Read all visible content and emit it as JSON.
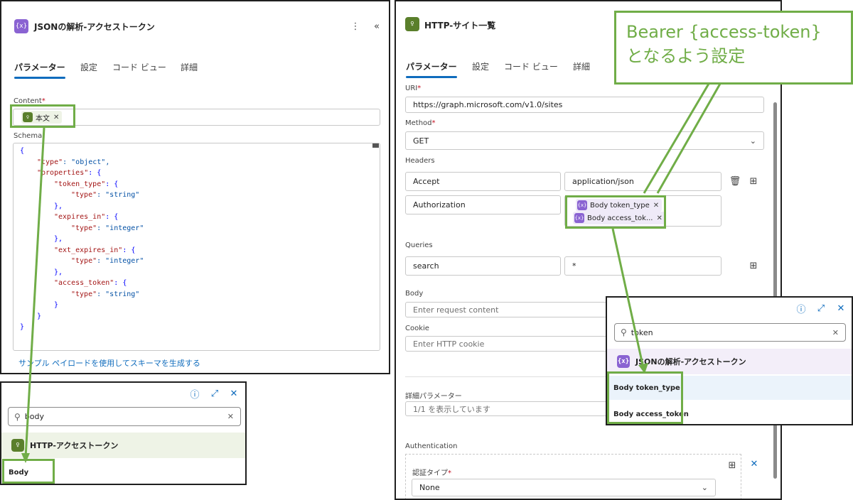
{
  "left_panel": {
    "title": "JSONの解析-アクセストークン",
    "tabs": [
      "パラメーター",
      "設定",
      "コード ビュー",
      "詳細"
    ],
    "content_label": "Content",
    "content_chip": "本文",
    "schema_label": "Schema",
    "schema_lines": [
      {
        "indent": 0,
        "key": "",
        "value": "{"
      },
      {
        "indent": 1,
        "key": "\"type\"",
        "value": ": \"object\","
      },
      {
        "indent": 1,
        "key": "\"properties\"",
        "value": ": {"
      },
      {
        "indent": 2,
        "key": "\"token_type\"",
        "value": ": {"
      },
      {
        "indent": 3,
        "key": "\"type\"",
        "value": ": \"string\""
      },
      {
        "indent": 2,
        "key": "",
        "value": "},"
      },
      {
        "indent": 2,
        "key": "\"expires_in\"",
        "value": ": {"
      },
      {
        "indent": 3,
        "key": "\"type\"",
        "value": ": \"integer\""
      },
      {
        "indent": 2,
        "key": "",
        "value": "},"
      },
      {
        "indent": 2,
        "key": "\"ext_expires_in\"",
        "value": ": {"
      },
      {
        "indent": 3,
        "key": "\"type\"",
        "value": ": \"integer\""
      },
      {
        "indent": 2,
        "key": "",
        "value": "},"
      },
      {
        "indent": 2,
        "key": "\"access_token\"",
        "value": ": {"
      },
      {
        "indent": 3,
        "key": "\"type\"",
        "value": ": \"string\""
      },
      {
        "indent": 2,
        "key": "",
        "value": "}"
      },
      {
        "indent": 1,
        "key": "",
        "value": "}"
      },
      {
        "indent": 0,
        "key": "",
        "value": "}"
      }
    ],
    "sample_link": "サンプル ペイロードを使用してスキーマを生成する"
  },
  "left_popup": {
    "search_value": "body",
    "group_label": "HTTP-アクセストークン",
    "item_label": "Body"
  },
  "right_panel": {
    "title": "HTTP-サイト一覧",
    "tabs": [
      "パラメーター",
      "設定",
      "コード ビュー",
      "詳細"
    ],
    "uri_label": "URI",
    "uri_value": "https://graph.microsoft.com/v1.0/sites",
    "method_label": "Method",
    "method_value": "GET",
    "headers_label": "Headers",
    "header_rows": [
      {
        "key": "Accept",
        "value": "application/json"
      },
      {
        "key": "Authorization",
        "value": ""
      }
    ],
    "auth_chips": [
      "Body token_type",
      "Body access_tok..."
    ],
    "queries_label": "Queries",
    "query_rows": [
      {
        "key": "search",
        "value": "*"
      }
    ],
    "body_label": "Body",
    "body_placeholder": "Enter request content",
    "cookie_label": "Cookie",
    "cookie_placeholder": "Enter HTTP cookie",
    "advanced_label": "詳細パラメーター",
    "advanced_value": "1/1 を表示しています",
    "auth_label": "Authentication",
    "auth_type_label": "認証タイプ",
    "auth_type_value": "None"
  },
  "right_popup": {
    "search_value": "token",
    "group_label": "JSONの解析-アクセストークン",
    "items": [
      "Body token_type",
      "Body access_token"
    ]
  },
  "callout": {
    "line1": "Bearer {access-token}",
    "line2": "となるよう設定"
  },
  "colors": {
    "highlight": "#70ad47",
    "accent": "#0f6cbd",
    "action_purple": "#8a63d2",
    "action_green": "#5a7f2b"
  }
}
